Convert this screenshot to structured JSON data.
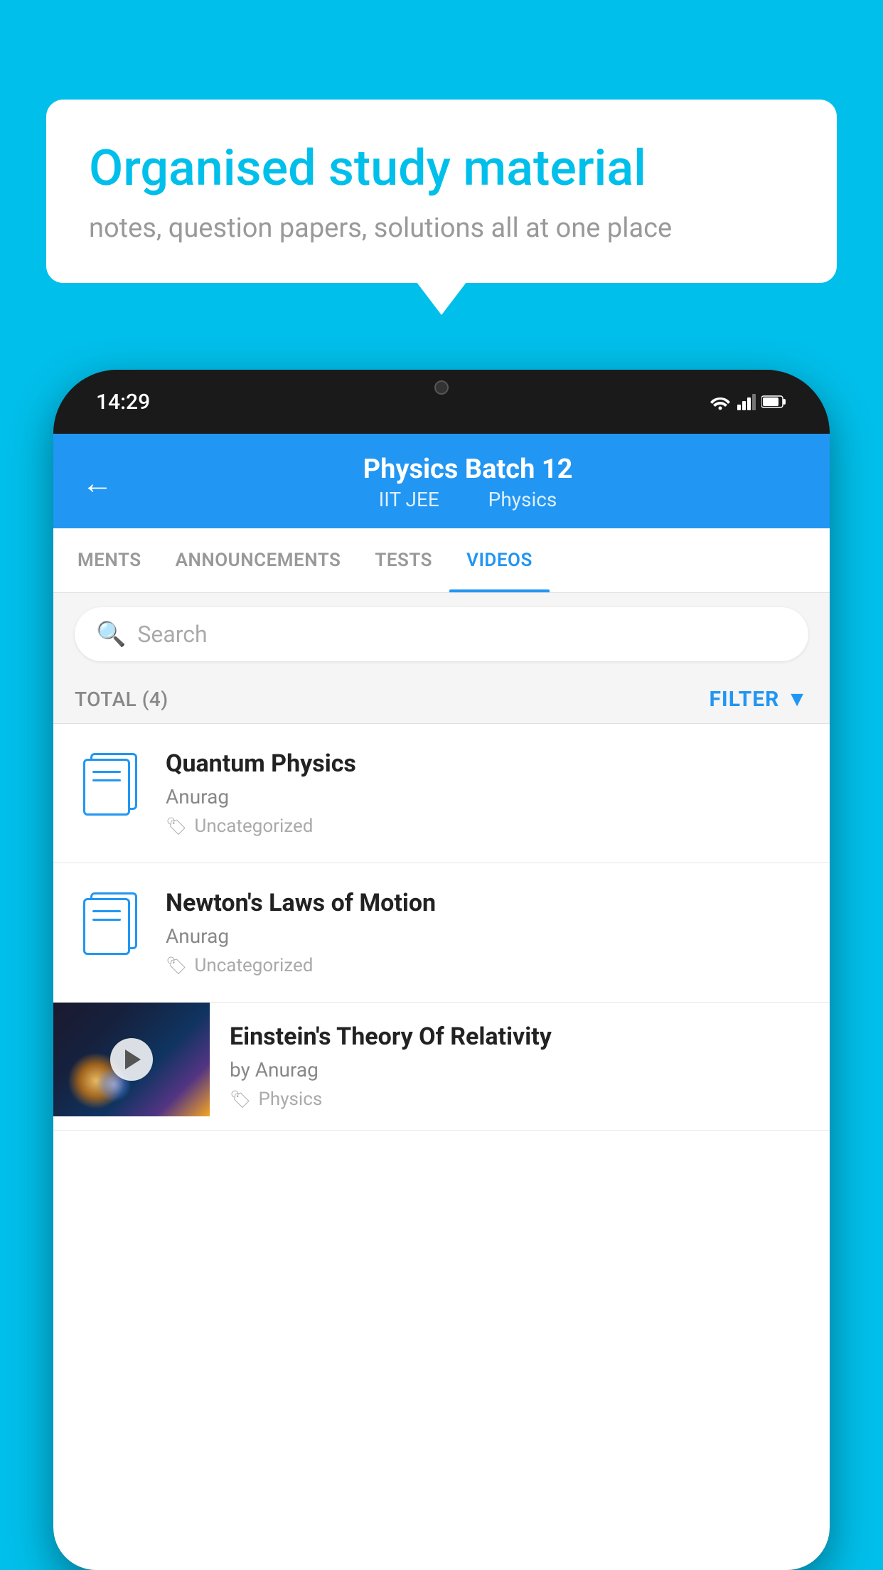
{
  "background": {
    "color": "#00BFEA"
  },
  "speech_bubble": {
    "title": "Organised study material",
    "subtitle": "notes, question papers, solutions all at one place"
  },
  "phone": {
    "status_bar": {
      "time": "14:29"
    },
    "header": {
      "back_label": "←",
      "title": "Physics Batch 12",
      "subtitle_part1": "IIT JEE",
      "subtitle_part2": "Physics"
    },
    "tabs": [
      {
        "label": "MENTS",
        "active": false
      },
      {
        "label": "ANNOUNCEMENTS",
        "active": false
      },
      {
        "label": "TESTS",
        "active": false
      },
      {
        "label": "VIDEOS",
        "active": true
      }
    ],
    "search": {
      "placeholder": "Search"
    },
    "filter": {
      "total_label": "TOTAL (4)",
      "filter_label": "FILTER"
    },
    "videos": [
      {
        "id": 1,
        "title": "Quantum Physics",
        "author": "Anurag",
        "tag": "Uncategorized",
        "has_thumbnail": false
      },
      {
        "id": 2,
        "title": "Newton's Laws of Motion",
        "author": "Anurag",
        "tag": "Uncategorized",
        "has_thumbnail": false
      },
      {
        "id": 3,
        "title": "Einstein's Theory Of Relativity",
        "author": "by Anurag",
        "tag": "Physics",
        "has_thumbnail": true
      }
    ]
  }
}
